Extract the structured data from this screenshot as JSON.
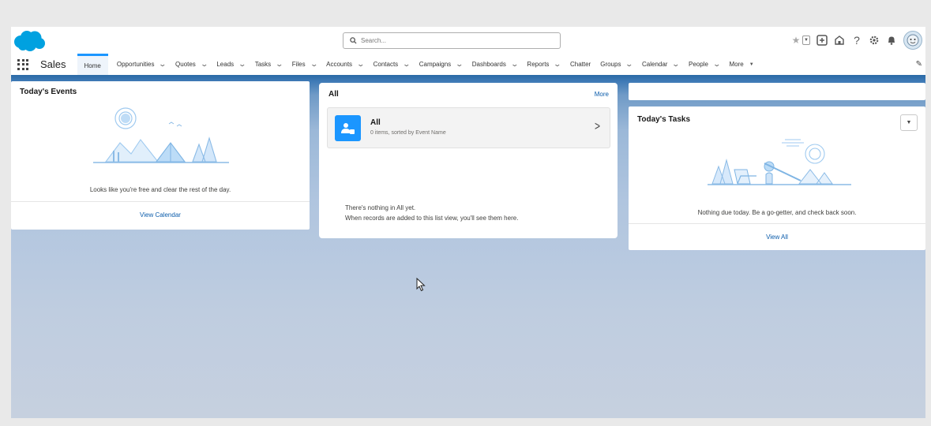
{
  "header": {
    "search": {
      "placeholder": "Search..."
    }
  },
  "nav": {
    "app_name": "Sales",
    "tabs": [
      {
        "label": "Home",
        "has_chevron": false,
        "active": true
      },
      {
        "label": "Opportunities",
        "has_chevron": true
      },
      {
        "label": "Quotes",
        "has_chevron": true
      },
      {
        "label": "Leads",
        "has_chevron": true
      },
      {
        "label": "Tasks",
        "has_chevron": true
      },
      {
        "label": "Files",
        "has_chevron": true
      },
      {
        "label": "Accounts",
        "has_chevron": true
      },
      {
        "label": "Contacts",
        "has_chevron": true
      },
      {
        "label": "Campaigns",
        "has_chevron": true
      },
      {
        "label": "Dashboards",
        "has_chevron": true
      },
      {
        "label": "Reports",
        "has_chevron": true
      },
      {
        "label": "Chatter",
        "has_chevron": false
      },
      {
        "label": "Groups",
        "has_chevron": true
      },
      {
        "label": "Calendar",
        "has_chevron": true
      },
      {
        "label": "People",
        "has_chevron": true
      }
    ],
    "more_label": "More"
  },
  "events": {
    "title": "Today's Events",
    "empty_message": "Looks like you're free and clear the rest of the day.",
    "view_link": "View Calendar"
  },
  "all_list": {
    "title": "All",
    "more_link": "More",
    "item_name": "All",
    "item_subtitle": "0 items, sorted by Event Name",
    "empty_line1": "There's nothing in All yet.",
    "empty_line2": "When records are added to this list view, you'll see them here."
  },
  "tasks": {
    "title": "Today's Tasks",
    "empty_message": "Nothing due today. Be a go-getter, and check back soon.",
    "view_link": "View All"
  },
  "colors": {
    "brand": "#00a1e0",
    "accent": "#1b96ff",
    "link": "#0b5cab"
  }
}
